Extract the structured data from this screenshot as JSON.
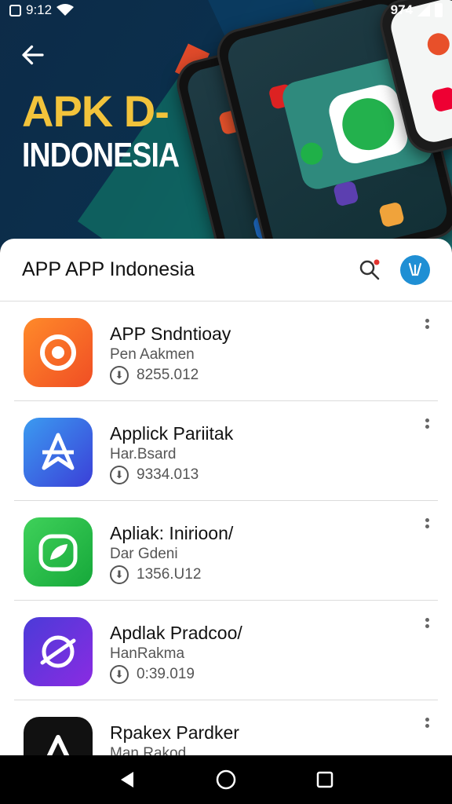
{
  "status_bar": {
    "left_time": "9:12",
    "right_text": "974"
  },
  "hero": {
    "title_line1": "APK D-",
    "title_line2": "INDONESIA",
    "accent_color": "#f2c33b"
  },
  "header": {
    "title": "APP APP Indonesia"
  },
  "apps": [
    {
      "name": "APP Sndntioay",
      "developer": "Pen Aakmen",
      "size": "8255.012",
      "icon": "orange-app-icon",
      "color": "#f36a2b"
    },
    {
      "name": "Applick Pariitak",
      "developer": "Har.Bsard",
      "size": "9334.013",
      "icon": "blue-app-icon",
      "color": "#2f6ee8"
    },
    {
      "name": "Apliak: Inirioon/",
      "developer": "Dar Gdeni",
      "size": "1356.U12",
      "icon": "green-app-icon",
      "color": "#22c046"
    },
    {
      "name": "Apdlak Pradcoo/",
      "developer": "HanRakma",
      "size": "0:39.019",
      "icon": "purple-app-icon",
      "color": "#6c2ed8"
    },
    {
      "name": "Rpakex Pardker",
      "developer": "Man Rakod",
      "size": "",
      "icon": "black-app-icon",
      "color": "#111111"
    }
  ],
  "icons": {
    "back": "back-arrow-icon",
    "search": "search-icon",
    "avatar": "avatar-icon",
    "download": "download-icon",
    "more": "more-vert-icon"
  }
}
